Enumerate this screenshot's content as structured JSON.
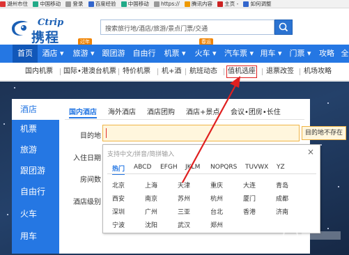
{
  "bookmarks": [
    {
      "label": "湖州市住",
      "color": "#d33"
    },
    {
      "label": "中国移动",
      "color": "#2a8"
    },
    {
      "label": "登录",
      "color": "#999"
    },
    {
      "label": "百度经验",
      "color": "#36c"
    },
    {
      "label": "中国移动",
      "color": "#2a8"
    },
    {
      "label": "https://",
      "color": "#999"
    },
    {
      "label": "腾讯内容",
      "color": "#e90"
    },
    {
      "label": "主页 -",
      "color": "#c22"
    },
    {
      "label": "如何调整",
      "color": "#36c"
    }
  ],
  "header": {
    "logo_en": "Ctrip",
    "logo_cn": "携程",
    "search_placeholder": "搜索旅行地/酒店/旅游/景点门票/交通"
  },
  "nav": {
    "items": [
      "首页",
      "酒店 ▾",
      "旅游 ▾",
      "跟团游",
      "自由行",
      "机票 ▾",
      "火车 ▾",
      "汽车票 ▾",
      "用车 ▾",
      "门票 ▾",
      "攻略",
      "全"
    ],
    "tag_holiday": "过年",
    "tag_spring": "春运"
  },
  "subnav": {
    "items": [
      "国内机票",
      "国际•港澳台机票",
      "特价机票",
      "机+酒",
      "航班动态",
      "值机选座",
      "退票改签",
      "机场攻略"
    ]
  },
  "sidebar": {
    "items": [
      "酒店",
      "机票",
      "旅游",
      "跟团游",
      "自由行",
      "火车",
      "用车"
    ]
  },
  "panel": {
    "tabs": [
      "国内酒店",
      "海外酒店",
      "酒店团购",
      "酒店+景点",
      "会议•团房•长住"
    ],
    "labels": [
      "目的地",
      "入住日期",
      "房间数",
      "酒店级别"
    ],
    "dest_error": "目的地不存在"
  },
  "dropdown": {
    "hint": "支持中文/拼音/简拼输入",
    "close": "×",
    "tabs": [
      "热门",
      "ABCD",
      "EFGH",
      "JKLM",
      "NOPQRS",
      "TUVWX",
      "YZ"
    ],
    "cities": [
      [
        "北京",
        "上海",
        "天津",
        "重庆",
        "大连",
        "青岛"
      ],
      [
        "西安",
        "南京",
        "苏州",
        "杭州",
        "厦门",
        "成都"
      ],
      [
        "深圳",
        "广州",
        "三亚",
        "台北",
        "香港",
        "济南"
      ],
      [
        "宁波",
        "沈阳",
        "武汉",
        "郑州"
      ]
    ]
  },
  "colors": {
    "brand_blue": "#2577e3",
    "nav_active": "#1157b8",
    "error_bg": "#fff6dd",
    "annotation_red": "#e02020"
  }
}
